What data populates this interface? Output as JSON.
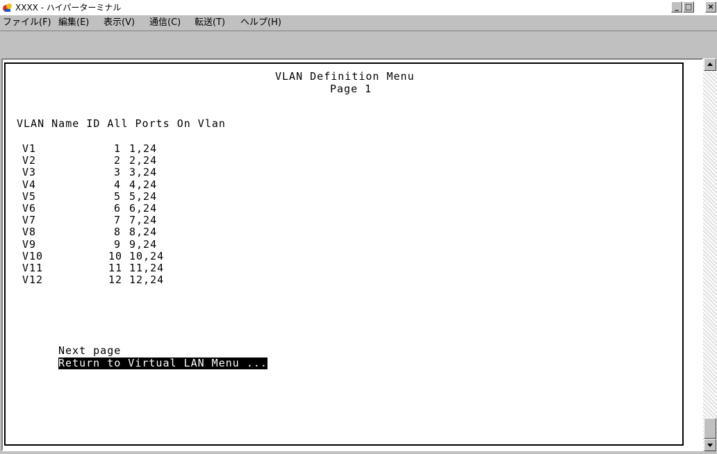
{
  "window": {
    "title": "XXXX - ハイパーターミナル",
    "controls": {
      "minimize": "_",
      "maximize": "□",
      "close": "×"
    }
  },
  "menu": {
    "items": [
      "ファイル(F)",
      "編集(E)",
      "表示(V)",
      "通信(C)",
      "転送(T)",
      "ヘルプ(H)"
    ]
  },
  "terminal": {
    "title": "VLAN Definition Menu",
    "page": "Page 1",
    "header": "VLAN Name ID All Ports On Vlan",
    "rows": [
      {
        "name": "V1",
        "id": "1",
        "ports": "1,24"
      },
      {
        "name": "V2",
        "id": "2",
        "ports": "2,24"
      },
      {
        "name": "V3",
        "id": "3",
        "ports": "3,24"
      },
      {
        "name": "V4",
        "id": "4",
        "ports": "4,24"
      },
      {
        "name": "V5",
        "id": "5",
        "ports": "5,24"
      },
      {
        "name": "V6",
        "id": "6",
        "ports": "6,24"
      },
      {
        "name": "V7",
        "id": "7",
        "ports": "7,24"
      },
      {
        "name": "V8",
        "id": "8",
        "ports": "8,24"
      },
      {
        "name": "V9",
        "id": "9",
        "ports": "9,24"
      },
      {
        "name": "V10",
        "id": "10",
        "ports": "10,24"
      },
      {
        "name": "V11",
        "id": "11",
        "ports": "11,24"
      },
      {
        "name": "V12",
        "id": "12",
        "ports": "12,24"
      }
    ],
    "options": [
      "Next page",
      "Return to Virtual LAN Menu ..."
    ],
    "selected_option": "Return to Virtual LAN Menu ..."
  },
  "colors": {
    "titlebar_bg": "#ffffff",
    "chrome": "#c0c0c0",
    "terminal_bg": "#ffffff",
    "highlight_bg": "#000000",
    "highlight_fg": "#ffffff"
  },
  "icons": {
    "app": "hyperterminal-icon",
    "scroll_up": "arrow-up-icon",
    "scroll_down": "arrow-down-icon"
  }
}
